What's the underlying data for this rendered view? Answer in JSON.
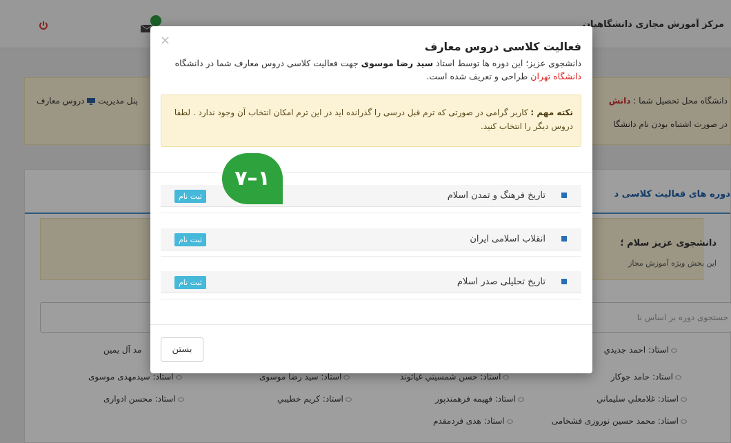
{
  "navbar": {
    "brand": "مرکز آموزش مجازی دانشگاهیان"
  },
  "background": {
    "alert_line1_label": "دانشگاه محل تحصیل شما :",
    "alert_line1_value": "دانش",
    "alert_line2": "در صورت اشتباه بودن نام دانشگا",
    "admin_link": "پنل مدیریت",
    "maaref_link": "دروس معارف",
    "panel_heading": "دوره های فعالیت کلاسی د",
    "warn_title": "دانشجوی عزیز سلام ؛",
    "warn_sub": "این بخش ویژه آموزش مجاز",
    "search_placeholder": "جستجوی دوره بر اساس نا",
    "professors_row1": [
      "استاد: احمد جدیدي",
      "مد آل یمین"
    ],
    "professors_row2": [
      "استاد: حامد جوکار",
      "استاد: حسن شمسیني غیاثوند",
      "استاد: سید رضا موسوی",
      "استاد: سیدمهدی موسوی"
    ],
    "professors_row3": [
      "استاد: غلامعلي سليماني",
      "استاد: فهیمه فرهمندپور",
      "استاد: کریم خطیبي",
      "استاد: محسن ادواری"
    ],
    "professors_row4": [
      "استاد: محمد حسین نوروزی فشخامی",
      "استاد: هدی فردمقدم"
    ]
  },
  "modal": {
    "close_symbol": "×",
    "title": "فعالیت کلاسی دروس معارف",
    "desc_part1": "دانشجوی عزیز؛ این دوره ها توسط استاد",
    "desc_teacher": "سید رضا موسوی",
    "desc_part2": "جهت فعالیت کلاسی دروس معارف شما در دانشگاه",
    "desc_university": "دانشگاه تهران",
    "desc_part3": "طراحی و تعریف شده است.",
    "note_label": "نکته مهم :",
    "note_text": "کاربر گرامی در صورتی که ترم قبل درسی را گذرانده اید در این ترم امکان انتخاب آن وجود ندارد . لطفا دروس دیگر را انتخاب کنید.",
    "courses": [
      {
        "name": "تاریخ فرهنگ و تمدن اسلام",
        "button": "ثبت نام"
      },
      {
        "name": "انقلاب اسلامی ایران",
        "button": "ثبت نام"
      },
      {
        "name": "تاریخ تحلیلی صدر اسلام",
        "button": "ثبت نام"
      }
    ],
    "close_button": "بستن"
  },
  "overlay": {
    "step_badge": "۷–۱"
  },
  "colors": {
    "accent_blue": "#46b8da",
    "badge_green": "#2ea23c",
    "university_red": "#e02020",
    "note_bg": "#fcf3d6"
  },
  "icons": [
    "power-icon",
    "mail-icon",
    "book-icon",
    "eye-icon",
    "monitor-icon",
    "close-icon"
  ]
}
